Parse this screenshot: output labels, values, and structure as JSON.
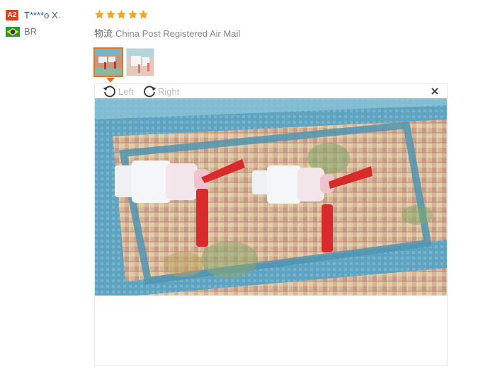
{
  "user": {
    "level_badge": "A2",
    "name": "T****o X.",
    "country_code": "BR"
  },
  "review": {
    "rating": 5,
    "rating_max": 5,
    "shipping_label": "物流",
    "shipping_method": "China Post Registered Air Mail"
  },
  "viewer": {
    "rotate_left_label": "Left",
    "rotate_right_label": "Right"
  },
  "colors": {
    "star": "#f5a623",
    "badge": "#e0401c",
    "username": "#2a5eac",
    "thumb_active": "#e8731f"
  },
  "icons": {
    "rotate_left": "rotate-left-icon",
    "rotate_right": "rotate-right-icon",
    "close": "close-icon",
    "flag": "brazil-flag-icon",
    "star": "star-icon"
  }
}
